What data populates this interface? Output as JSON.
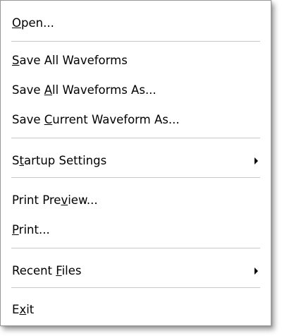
{
  "menu": {
    "items": [
      {
        "pre": "",
        "key": "O",
        "post": "pen..."
      },
      {
        "pre": "",
        "key": "S",
        "post": "ave All Waveforms"
      },
      {
        "pre": "Save ",
        "key": "A",
        "post": "ll Waveforms As..."
      },
      {
        "pre": "Save ",
        "key": "C",
        "post": "urrent Waveform As..."
      },
      {
        "pre": "S",
        "key": "t",
        "post": "artup Settings"
      },
      {
        "pre": "Print Pre",
        "key": "v",
        "post": "iew..."
      },
      {
        "pre": "",
        "key": "P",
        "post": "rint..."
      },
      {
        "pre": "Recent ",
        "key": "F",
        "post": "iles"
      },
      {
        "pre": "E",
        "key": "x",
        "post": "it"
      }
    ]
  }
}
